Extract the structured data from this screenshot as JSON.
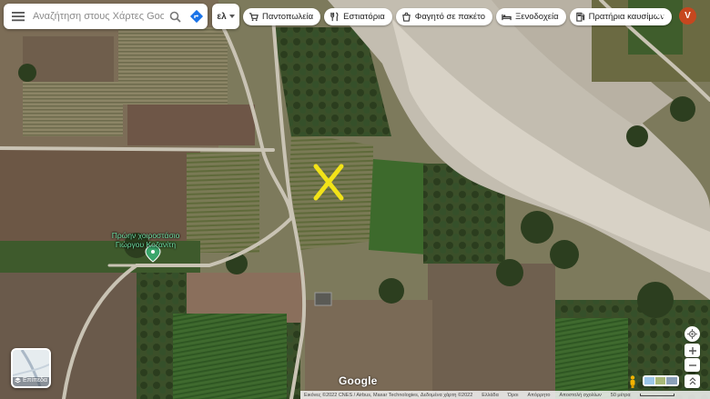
{
  "search": {
    "placeholder": "Αναζήτηση στους Χάρτες Google",
    "menu_icon": "menu-icon",
    "search_icon": "search-icon",
    "directions_icon": "directions-icon"
  },
  "language": {
    "label": "ελ"
  },
  "chips": [
    {
      "label": "Παντοπωλεία",
      "icon": "cart-icon"
    },
    {
      "label": "Εστιατόρια",
      "icon": "restaurant-icon"
    },
    {
      "label": "Φαγητό σε πακέτο",
      "icon": "takeout-icon"
    },
    {
      "label": "Ξενοδοχεία",
      "icon": "hotel-icon"
    },
    {
      "label": "Πρατήρια καυσίμων",
      "icon": "fuel-icon"
    }
  ],
  "account": {
    "initial": "V",
    "color": "#c6471f"
  },
  "map": {
    "poi_label_line1": "Πρώην χοιροστάσιο",
    "poi_label_line2": "Γιώργου Κοζανίτη",
    "marker_color": "#f2e318",
    "poi_color": "#6fe0a4"
  },
  "layers": {
    "label": "Επίπεδα"
  },
  "brand": {
    "logo": "Google"
  },
  "footer": {
    "imagery": "Εικόνες ©2022 CNES / Airbus, Maxar Technologies, Δεδομένα χάρτη ©2022",
    "country": "Ελλάδα",
    "terms": "Όροι",
    "privacy": "Απόρρητο",
    "feedback": "Αποστολή σχολίων",
    "scale": "50 μέτρα"
  }
}
